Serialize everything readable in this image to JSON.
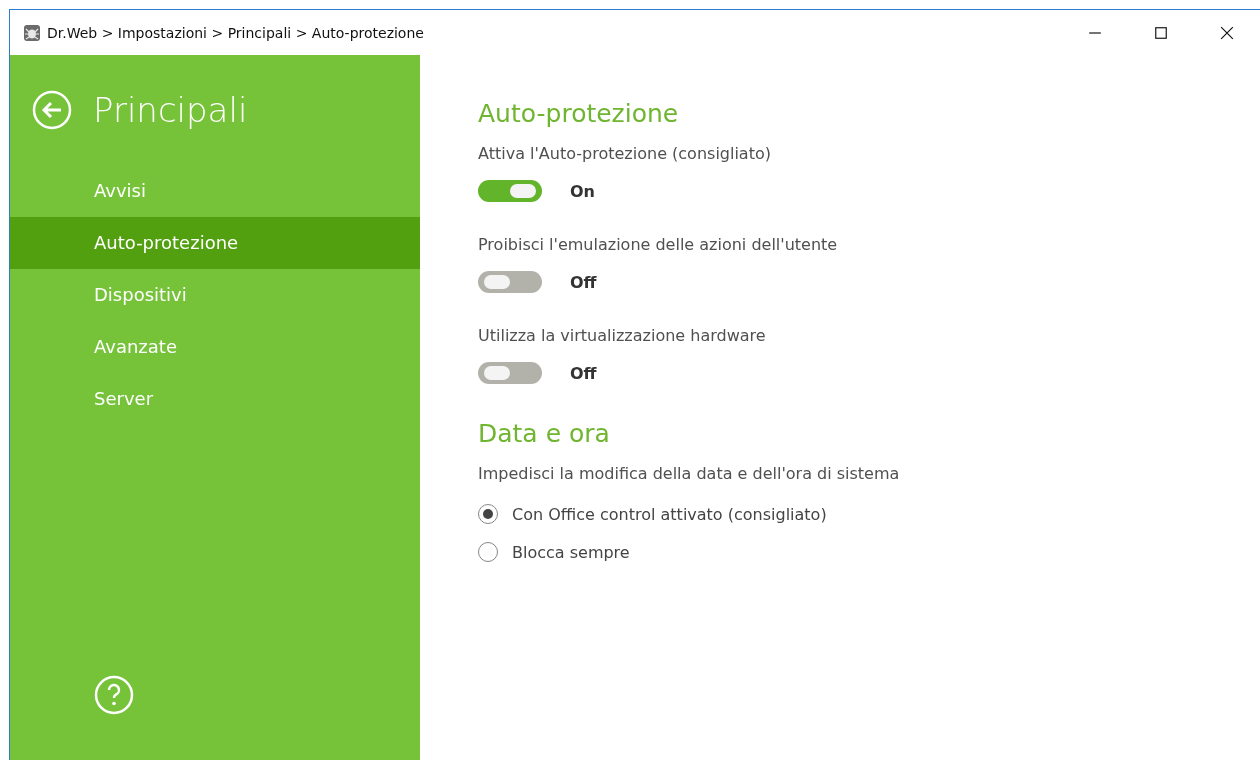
{
  "window": {
    "title": "Dr.Web > Impostazioni > Principali > Auto-protezione"
  },
  "sidebar": {
    "title": "Principali",
    "items": [
      {
        "label": "Avvisi",
        "selected": false
      },
      {
        "label": "Auto-protezione",
        "selected": true
      },
      {
        "label": "Dispositivi",
        "selected": false
      },
      {
        "label": "Avanzate",
        "selected": false
      },
      {
        "label": "Server",
        "selected": false
      }
    ]
  },
  "sections": [
    {
      "title": "Auto-protezione",
      "settings": [
        {
          "kind": "toggle",
          "label": "Attiva l'Auto-protezione (consigliato)",
          "on": true,
          "state_text": "On"
        },
        {
          "kind": "toggle",
          "label": "Proibisci l'emulazione delle azioni dell'utente",
          "on": false,
          "state_text": "Off"
        },
        {
          "kind": "toggle",
          "label": "Utilizza la virtualizzazione hardware",
          "on": false,
          "state_text": "Off"
        }
      ]
    },
    {
      "title": "Data e ora",
      "settings": [
        {
          "kind": "radio",
          "label": "Impedisci la modifica della data e dell'ora di sistema",
          "options": [
            {
              "label": "Con Office control attivato (consigliato)",
              "selected": true
            },
            {
              "label": "Blocca sempre",
              "selected": false
            }
          ]
        }
      ]
    }
  ]
}
